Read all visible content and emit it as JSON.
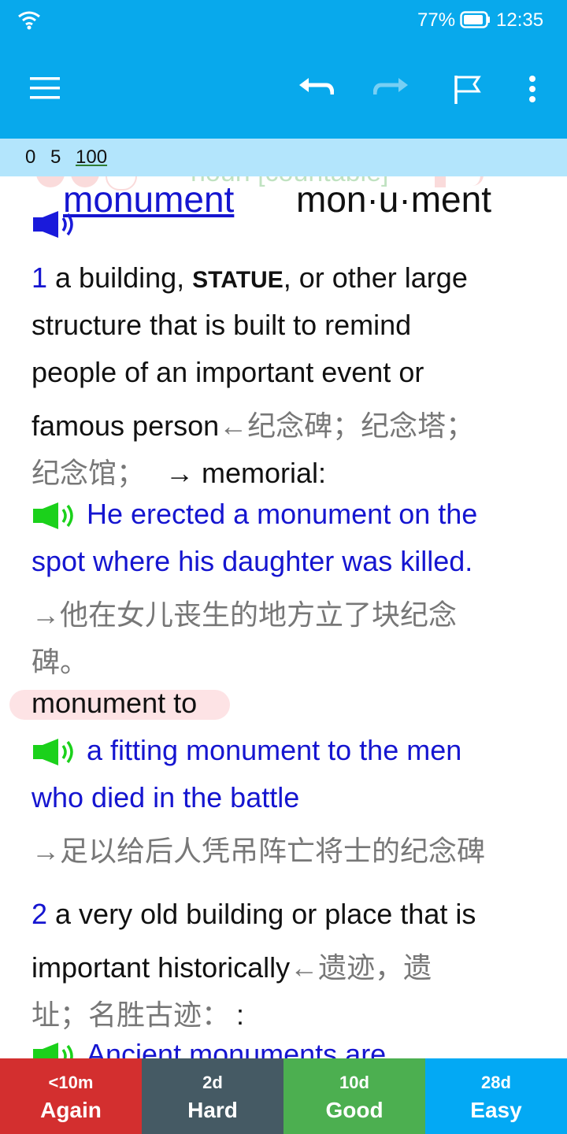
{
  "status": {
    "battery_pct": "77%",
    "time": "12:35"
  },
  "counts": {
    "new": "0",
    "learning": "5",
    "review": "100"
  },
  "card": {
    "overlay_text": "noun [countable]",
    "headword": "monument",
    "syllables": "mon·u·ment",
    "sense1": {
      "num": "1",
      "def_a": "a building, ",
      "def_sc": "STATUE",
      "def_b": ", or other large",
      "def_line2": "structure that is built to remind",
      "def_line3": "people of an important event or",
      "def_line4": "famous person",
      "def_line4_cn": "←纪念碑；纪念塔；",
      "def_line5_cn": "纪念馆；",
      "def_line5": " → memorial:",
      "ex1_line1": "He erected a monument on the",
      "ex1_line2": "spot where his daughter was killed.",
      "ex1_cn_line1": "→他在女儿丧生的地方立了块纪念",
      "ex1_cn_line2": "碑。",
      "collocation": "monument to",
      "ex2_line1": "a fitting monument to the men",
      "ex2_line2": "who died in the battle",
      "ex2_cn": "→足以给后人凭吊阵亡将士的纪念碑"
    },
    "sense2": {
      "num": "2",
      "def_line1": "a very old building or place that is",
      "def_line2": "important historically",
      "def_line2_cn": "←遗迹，遗",
      "def_line3_cn": "址；名胜古迹：",
      "def_line3_colon": ":",
      "ex1_partial": "Ancient monuments are"
    }
  },
  "answers": [
    {
      "interval": "<10m",
      "label": "Again",
      "color": "#d32f2f"
    },
    {
      "interval": "2d",
      "label": "Hard",
      "color": "#455a64"
    },
    {
      "interval": "10d",
      "label": "Good",
      "color": "#4caf50"
    },
    {
      "interval": "28d",
      "label": "Easy",
      "color": "#03a9f4"
    }
  ],
  "icons": [
    "wifi-icon",
    "battery-icon",
    "menu-icon",
    "undo-icon",
    "redo-icon",
    "flag-icon",
    "more-vert-icon",
    "speaker-icon"
  ]
}
